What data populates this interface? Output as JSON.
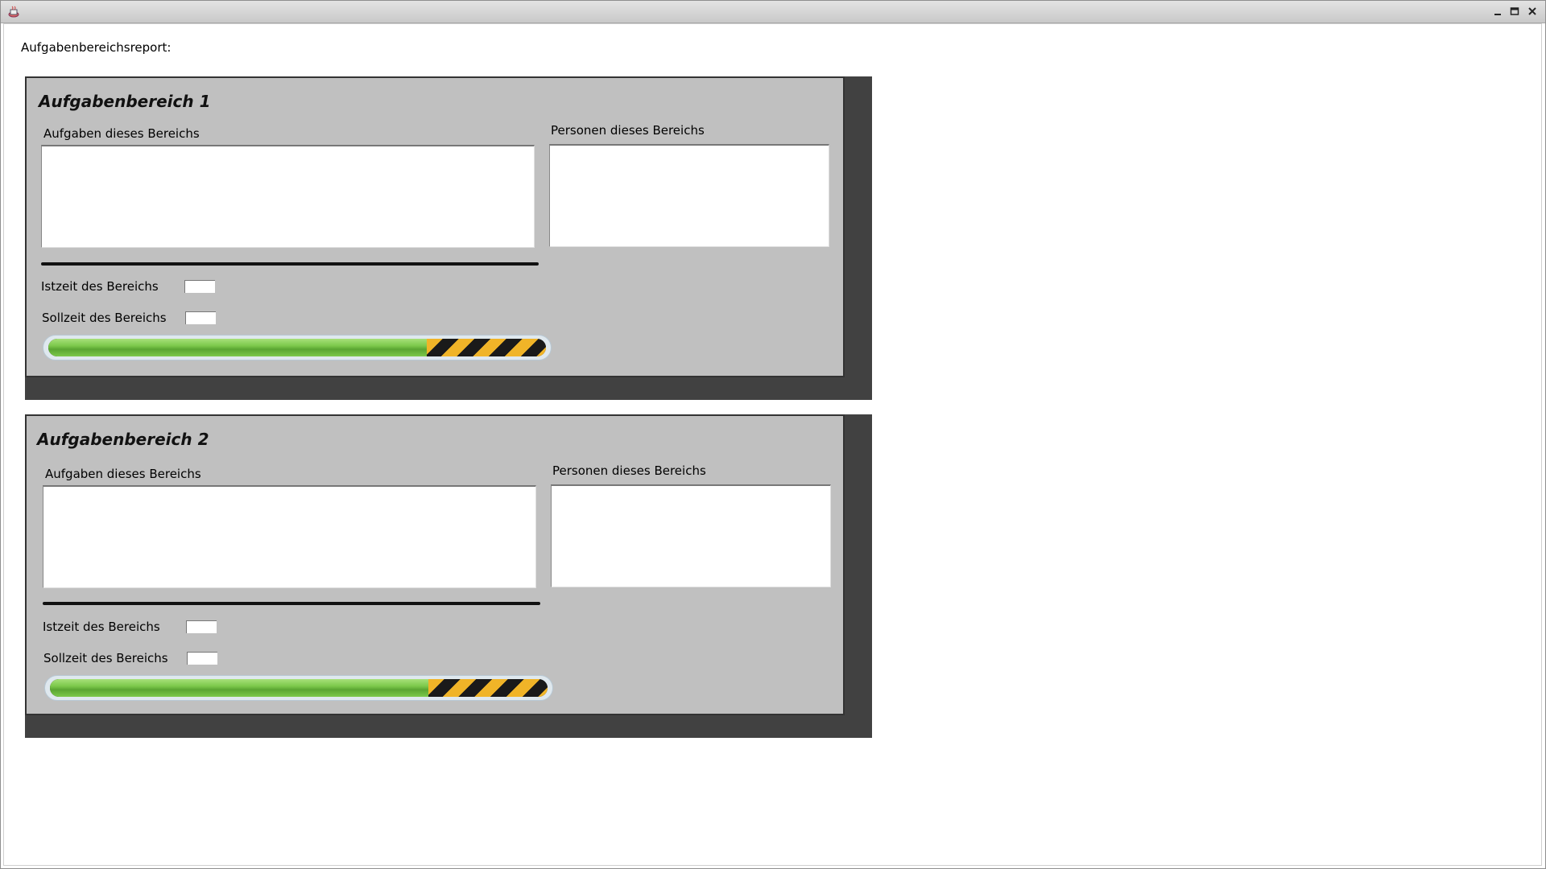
{
  "window": {
    "title": "",
    "controls": [
      "minimize-icon",
      "maximize-icon",
      "close-icon"
    ]
  },
  "report": {
    "label": "Aufgabenbereichsreport:"
  },
  "panels": [
    {
      "title": "Aufgabenbereich 1",
      "tasks_label": "Aufgaben dieses Bereichs",
      "persons_label": "Personen dieses Bereichs",
      "ist_label": "Istzeit des Bereichs",
      "ist_value": "",
      "soll_label": "Sollzeit des Bereichs",
      "soll_value": "",
      "progress_fraction": 0.76
    },
    {
      "title": "Aufgabenbereich 2",
      "tasks_label": "Aufgaben dieses Bereichs",
      "persons_label": "Personen dieses Bereichs",
      "ist_label": "Istzeit des Bereichs",
      "ist_value": "",
      "soll_label": "Sollzeit des Bereichs",
      "soll_value": "",
      "progress_fraction": 0.76
    }
  ],
  "colors": {
    "panel_bg": "#c0c0c0",
    "panel_shadow": "#414141",
    "progress_green": "#7cc84b",
    "hazard_yellow": "#f0b428"
  }
}
